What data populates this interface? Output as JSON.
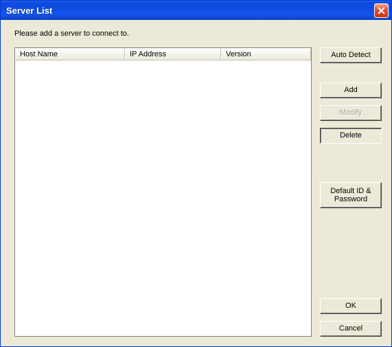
{
  "window": {
    "title": "Server List"
  },
  "instruction": "Please add a server to connect to.",
  "table": {
    "columns": {
      "host": "Host Name",
      "ip": "IP Address",
      "version": "Version"
    },
    "rows": []
  },
  "buttons": {
    "auto_detect": "Auto Detect",
    "add": "Add",
    "modify": "Modify",
    "delete": "Delete",
    "default_id": "Default ID & Password",
    "ok": "OK",
    "cancel": "Cancel"
  }
}
